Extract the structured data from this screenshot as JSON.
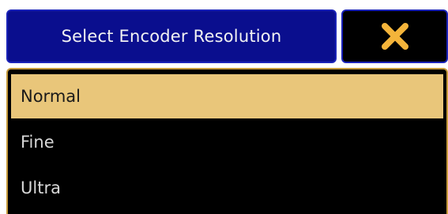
{
  "dialog": {
    "title": "Select Encoder Resolution",
    "close_icon": "close-icon"
  },
  "options": [
    {
      "label": "Normal",
      "selected": true
    },
    {
      "label": "Fine",
      "selected": false
    },
    {
      "label": "Ultra",
      "selected": false
    }
  ],
  "colors": {
    "title_bg": "#0a0e8e",
    "border_blue": "#1a22b8",
    "selected_bg": "#e9c67a",
    "panel_border": "#c69a3a",
    "close_icon": "#f4b43a"
  }
}
